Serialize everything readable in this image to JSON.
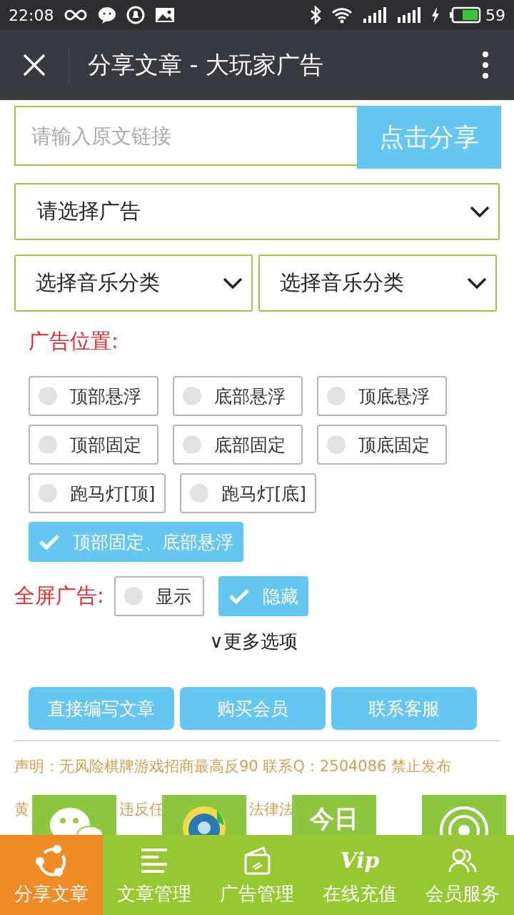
{
  "status_bar": {
    "time": "22:08",
    "battery": "59"
  },
  "title_bar": {
    "title": "分享文章 - 大玩家广告"
  },
  "link_input": {
    "placeholder": "请输入原文链接"
  },
  "share_button": "点击分享",
  "ad_select": {
    "value": "请选择广告"
  },
  "music_selects": [
    {
      "value": "选择音乐分类"
    },
    {
      "value": "选择音乐分类"
    }
  ],
  "ad_position": {
    "label": "广告位置:",
    "options": [
      {
        "label": "顶部悬浮",
        "selected": false
      },
      {
        "label": "底部悬浮",
        "selected": false
      },
      {
        "label": "顶底悬浮",
        "selected": false
      },
      {
        "label": "顶部固定",
        "selected": false
      },
      {
        "label": "底部固定",
        "selected": false
      },
      {
        "label": "顶底固定",
        "selected": false
      },
      {
        "label": "跑马灯[顶]",
        "selected": false
      },
      {
        "label": "跑马灯[底]",
        "selected": false
      },
      {
        "label": "顶部固定、底部悬浮",
        "selected": true
      }
    ]
  },
  "fullscreen_ad": {
    "label": "全屏广告:",
    "options": [
      {
        "label": "显示",
        "selected": false
      },
      {
        "label": "隐藏",
        "selected": true
      }
    ]
  },
  "more_options": "∨更多选项",
  "actions": [
    "直接编写文章",
    "购买会员",
    "联系客服"
  ],
  "disclaimer": {
    "line_1": "声明：无风险棋牌游戏招商最高反90 联系Q：2504086 禁止发布",
    "line_2_fragments": [
      "黄",
      "违反任",
      "法律法"
    ]
  },
  "share_targets": [
    {
      "kind": "chat"
    },
    {
      "kind": "browser"
    },
    {
      "kind": "news",
      "text": "今日"
    },
    {
      "kind": "music"
    }
  ],
  "bottom_nav": [
    {
      "label": "分享文章",
      "kind": "share",
      "selected": true
    },
    {
      "label": "文章管理",
      "kind": "list",
      "selected": false
    },
    {
      "label": "广告管理",
      "kind": "card",
      "selected": false
    },
    {
      "label": "在线充值",
      "kind": "vip",
      "icon_text": "Vip",
      "selected": false
    },
    {
      "label": "会员服务",
      "kind": "users",
      "selected": false
    }
  ]
}
